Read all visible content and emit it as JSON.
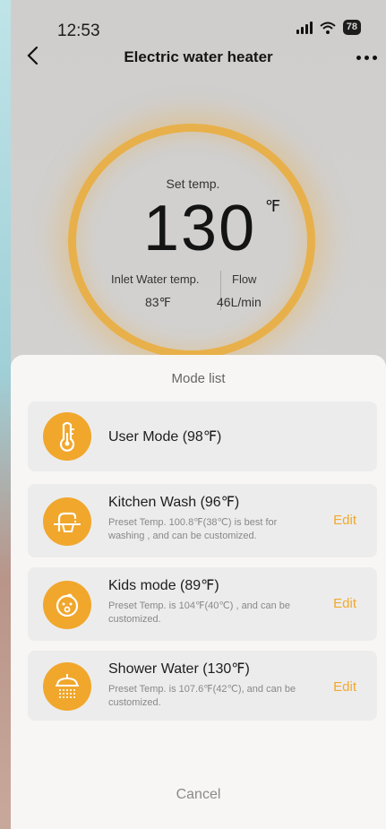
{
  "status_bar": {
    "time": "12:53",
    "battery": "78"
  },
  "header": {
    "title": "Electric water heater"
  },
  "dial": {
    "set_label": "Set temp.",
    "set_value": "130",
    "unit": "℉",
    "inlet_label": "Inlet Water temp.",
    "inlet_value": "83℉",
    "flow_label": "Flow",
    "flow_value": "46L/min",
    "ring_color": "#e8b04a"
  },
  "mode_list": {
    "title": "Mode list",
    "accent": "#f0a72c",
    "edit_color": "#f1a92c",
    "items": [
      {
        "name": "User Mode (98℉)",
        "icon": "thermometer-icon"
      },
      {
        "name": "Kitchen Wash (96℉)",
        "desc": "Preset Temp. 100.8℉(38℃) is best for washing , and can be customized.",
        "edit": "Edit",
        "icon": "faucet-icon"
      },
      {
        "name": "Kids mode (89℉)",
        "desc": "Preset Temp. is 104℉(40℃) ,  and can be customized.",
        "edit": "Edit",
        "icon": "baby-icon"
      },
      {
        "name": "Shower Water (130℉)",
        "desc": "Preset Temp. is 107.6℉(42℃),  and can be customized.",
        "edit": "Edit",
        "icon": "shower-icon"
      }
    ],
    "cancel": "Cancel"
  }
}
